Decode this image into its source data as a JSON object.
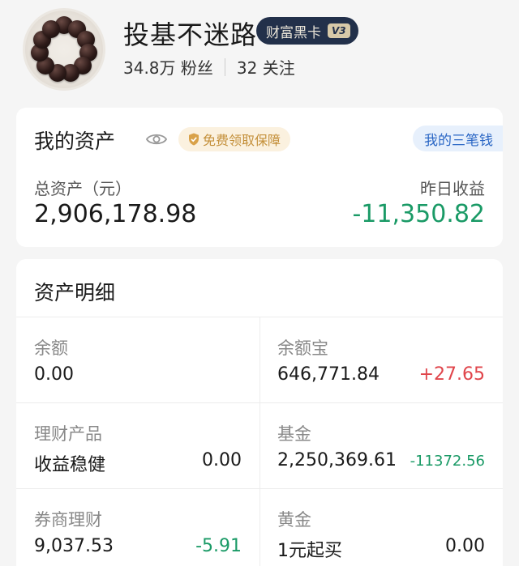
{
  "profile": {
    "username": "投基不迷路",
    "badge_label": "财富黑卡",
    "badge_level": "V3",
    "followers": "34.8万 粉丝",
    "following": "32 关注"
  },
  "assets_card": {
    "title": "我的资产",
    "protect_label": "免费领取保障",
    "three_money_label": "我的三笔钱",
    "total_label": "总资产（元）",
    "total_value": "2,906,178.98",
    "yesterday_label": "昨日收益",
    "yesterday_value": "-11,350.82"
  },
  "detail_card": {
    "title": "资产明细",
    "items": [
      {
        "label": "余额",
        "value": "0.00",
        "change": ""
      },
      {
        "label": "余额宝",
        "value": "646,771.84",
        "change": "+27.65"
      },
      {
        "label": "理财产品",
        "value": "收益稳健",
        "change": "0.00"
      },
      {
        "label": "基金",
        "value": "2,250,369.61",
        "change": "-11372.56"
      },
      {
        "label": "券商理财",
        "value": "9,037.53",
        "change": "-5.91"
      },
      {
        "label": "黄金",
        "value": "1元起买",
        "change": "0.00"
      }
    ]
  },
  "colors": {
    "positive": "#e0454b",
    "negative": "#1a9a66",
    "badge_bg": "#22304a",
    "link_blue": "#2b67c5"
  },
  "icons": {
    "avatar": "bead-bracelet-avatar",
    "eye": "eye-icon",
    "shield": "shield-check-icon"
  }
}
